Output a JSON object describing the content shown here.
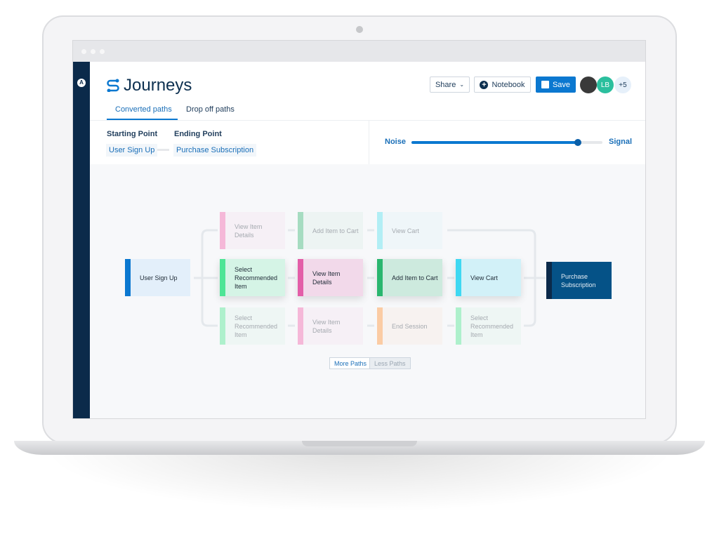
{
  "app": {
    "title": "Journeys"
  },
  "header": {
    "share_label": "Share",
    "notebook_label": "Notebook",
    "save_label": "Save",
    "avatars": [
      {
        "initials": "",
        "color": "#3a3a3a"
      },
      {
        "initials": "LB",
        "color": "#2bbf9e"
      },
      {
        "initials": "+5",
        "color": "#e6f0fa"
      }
    ]
  },
  "tabs": [
    {
      "label": "Converted paths",
      "active": true
    },
    {
      "label": "Drop off paths",
      "active": false
    }
  ],
  "filters": {
    "starting_label": "Starting Point",
    "ending_label": "Ending Point",
    "start_value": "User Sign Up",
    "end_value": "Purchase Subscription"
  },
  "slider": {
    "left_label": "Noise",
    "right_label": "Signal",
    "value_percent": 87
  },
  "journey": {
    "start": {
      "label": "User Sign Up",
      "color": "#0b78d0"
    },
    "end": {
      "label": "Purchase Subscription",
      "color": "#0b2a4a"
    },
    "rows": [
      [
        {
          "label": "View Item Details",
          "color": "#f5b8d8",
          "faded": true
        },
        {
          "label": "Add Item to Cart",
          "color": "#a6dcc1",
          "faded": true
        },
        {
          "label": "View Cart",
          "color": "#b2eef5",
          "faded": true
        }
      ],
      [
        {
          "label": "Select Recommended Item",
          "color": "#4ee596",
          "faded": false
        },
        {
          "label": "View Item Details",
          "color": "#e35ea8",
          "faded": false
        },
        {
          "label": "Add Item to Cart",
          "color": "#2ab66f",
          "faded": false
        },
        {
          "label": "View Cart",
          "color": "#3fd8f2",
          "faded": false
        }
      ],
      [
        {
          "label": "Select Recommended Item",
          "color": "#aef0cc",
          "faded": true
        },
        {
          "label": "View Item Details",
          "color": "#f5b8d8",
          "faded": true
        },
        {
          "label": "End Session",
          "color": "#fbcca4",
          "faded": true
        },
        {
          "label": "Select Recommended Item",
          "color": "#aef0cc",
          "faded": true
        }
      ]
    ]
  },
  "paths_toggle": {
    "more_label": "More Paths",
    "less_label": "Less Paths"
  }
}
